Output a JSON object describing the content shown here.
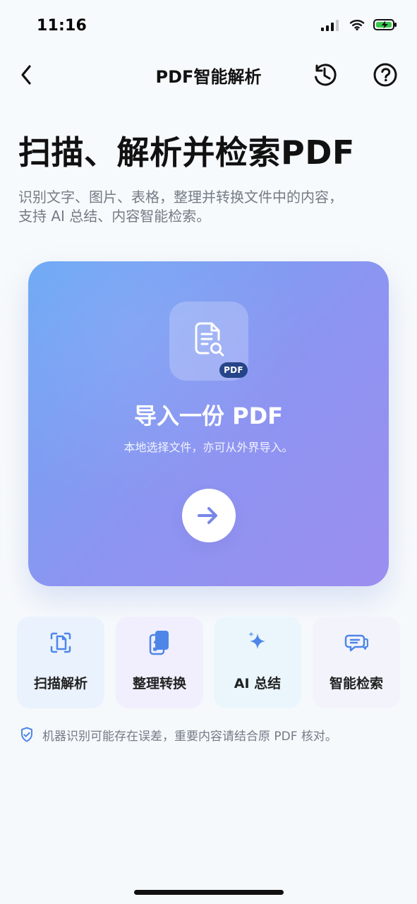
{
  "status_bar": {
    "time": "11:16",
    "icons": [
      "signal-icon",
      "wifi-icon",
      "battery-charging-icon"
    ]
  },
  "nav": {
    "title": "PDF智能解析",
    "back_icon": "chevron-left-icon",
    "history_icon": "history-icon",
    "help_icon": "help-icon"
  },
  "hero": {
    "title": "扫描、解析并检索PDF",
    "subtitle": "识别文字、图片、表格，整理并转换文件中的内容，\n支持 AI 总结、内容智能检索。"
  },
  "import_card": {
    "badge": "PDF",
    "title": "导入一份 PDF",
    "subtitle": "本地选择文件，亦可从外界导入。",
    "icon": "document-search-icon",
    "arrow_icon": "arrow-right-icon",
    "gradient": [
      "#6ba8f5",
      "#9b8ef0"
    ]
  },
  "features": [
    {
      "label": "扫描解析",
      "icon": "scan-document-icon",
      "bg": "#eaf2fd"
    },
    {
      "label": "整理转换",
      "icon": "convert-document-icon",
      "bg": "#f1effd"
    },
    {
      "label": "AI 总结",
      "icon": "ai-sparkles-icon",
      "bg": "#eaf6fb"
    },
    {
      "label": "智能检索",
      "icon": "chat-search-icon",
      "bg": "#f3f4fb"
    }
  ],
  "notice": {
    "icon": "shield-check-icon",
    "text": "机器识别可能存在误差，重要内容请结合原 PDF 核对。"
  },
  "colors": {
    "primary_blue": "#4e86e8",
    "text_dark": "#111111",
    "text_muted": "#747b86"
  }
}
